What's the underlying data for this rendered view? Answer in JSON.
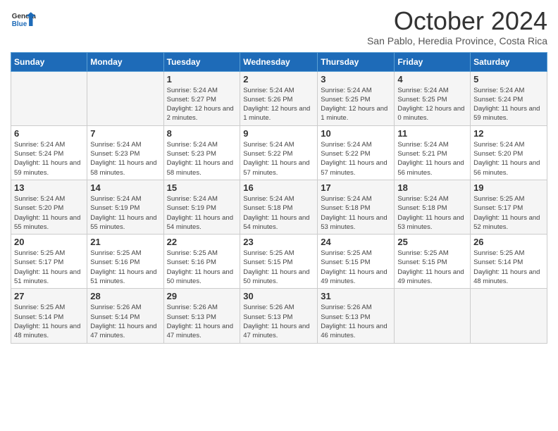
{
  "logo": {
    "line1": "General",
    "line2": "Blue"
  },
  "title": "October 2024",
  "subtitle": "San Pablo, Heredia Province, Costa Rica",
  "days_header": [
    "Sunday",
    "Monday",
    "Tuesday",
    "Wednesday",
    "Thursday",
    "Friday",
    "Saturday"
  ],
  "weeks": [
    [
      {
        "day": "",
        "sunrise": "",
        "sunset": "",
        "daylight": ""
      },
      {
        "day": "",
        "sunrise": "",
        "sunset": "",
        "daylight": ""
      },
      {
        "day": "1",
        "sunrise": "Sunrise: 5:24 AM",
        "sunset": "Sunset: 5:27 PM",
        "daylight": "Daylight: 12 hours and 2 minutes."
      },
      {
        "day": "2",
        "sunrise": "Sunrise: 5:24 AM",
        "sunset": "Sunset: 5:26 PM",
        "daylight": "Daylight: 12 hours and 1 minute."
      },
      {
        "day": "3",
        "sunrise": "Sunrise: 5:24 AM",
        "sunset": "Sunset: 5:25 PM",
        "daylight": "Daylight: 12 hours and 1 minute."
      },
      {
        "day": "4",
        "sunrise": "Sunrise: 5:24 AM",
        "sunset": "Sunset: 5:25 PM",
        "daylight": "Daylight: 12 hours and 0 minutes."
      },
      {
        "day": "5",
        "sunrise": "Sunrise: 5:24 AM",
        "sunset": "Sunset: 5:24 PM",
        "daylight": "Daylight: 11 hours and 59 minutes."
      }
    ],
    [
      {
        "day": "6",
        "sunrise": "Sunrise: 5:24 AM",
        "sunset": "Sunset: 5:24 PM",
        "daylight": "Daylight: 11 hours and 59 minutes."
      },
      {
        "day": "7",
        "sunrise": "Sunrise: 5:24 AM",
        "sunset": "Sunset: 5:23 PM",
        "daylight": "Daylight: 11 hours and 58 minutes."
      },
      {
        "day": "8",
        "sunrise": "Sunrise: 5:24 AM",
        "sunset": "Sunset: 5:23 PM",
        "daylight": "Daylight: 11 hours and 58 minutes."
      },
      {
        "day": "9",
        "sunrise": "Sunrise: 5:24 AM",
        "sunset": "Sunset: 5:22 PM",
        "daylight": "Daylight: 11 hours and 57 minutes."
      },
      {
        "day": "10",
        "sunrise": "Sunrise: 5:24 AM",
        "sunset": "Sunset: 5:22 PM",
        "daylight": "Daylight: 11 hours and 57 minutes."
      },
      {
        "day": "11",
        "sunrise": "Sunrise: 5:24 AM",
        "sunset": "Sunset: 5:21 PM",
        "daylight": "Daylight: 11 hours and 56 minutes."
      },
      {
        "day": "12",
        "sunrise": "Sunrise: 5:24 AM",
        "sunset": "Sunset: 5:20 PM",
        "daylight": "Daylight: 11 hours and 56 minutes."
      }
    ],
    [
      {
        "day": "13",
        "sunrise": "Sunrise: 5:24 AM",
        "sunset": "Sunset: 5:20 PM",
        "daylight": "Daylight: 11 hours and 55 minutes."
      },
      {
        "day": "14",
        "sunrise": "Sunrise: 5:24 AM",
        "sunset": "Sunset: 5:19 PM",
        "daylight": "Daylight: 11 hours and 55 minutes."
      },
      {
        "day": "15",
        "sunrise": "Sunrise: 5:24 AM",
        "sunset": "Sunset: 5:19 PM",
        "daylight": "Daylight: 11 hours and 54 minutes."
      },
      {
        "day": "16",
        "sunrise": "Sunrise: 5:24 AM",
        "sunset": "Sunset: 5:18 PM",
        "daylight": "Daylight: 11 hours and 54 minutes."
      },
      {
        "day": "17",
        "sunrise": "Sunrise: 5:24 AM",
        "sunset": "Sunset: 5:18 PM",
        "daylight": "Daylight: 11 hours and 53 minutes."
      },
      {
        "day": "18",
        "sunrise": "Sunrise: 5:24 AM",
        "sunset": "Sunset: 5:18 PM",
        "daylight": "Daylight: 11 hours and 53 minutes."
      },
      {
        "day": "19",
        "sunrise": "Sunrise: 5:25 AM",
        "sunset": "Sunset: 5:17 PM",
        "daylight": "Daylight: 11 hours and 52 minutes."
      }
    ],
    [
      {
        "day": "20",
        "sunrise": "Sunrise: 5:25 AM",
        "sunset": "Sunset: 5:17 PM",
        "daylight": "Daylight: 11 hours and 51 minutes."
      },
      {
        "day": "21",
        "sunrise": "Sunrise: 5:25 AM",
        "sunset": "Sunset: 5:16 PM",
        "daylight": "Daylight: 11 hours and 51 minutes."
      },
      {
        "day": "22",
        "sunrise": "Sunrise: 5:25 AM",
        "sunset": "Sunset: 5:16 PM",
        "daylight": "Daylight: 11 hours and 50 minutes."
      },
      {
        "day": "23",
        "sunrise": "Sunrise: 5:25 AM",
        "sunset": "Sunset: 5:15 PM",
        "daylight": "Daylight: 11 hours and 50 minutes."
      },
      {
        "day": "24",
        "sunrise": "Sunrise: 5:25 AM",
        "sunset": "Sunset: 5:15 PM",
        "daylight": "Daylight: 11 hours and 49 minutes."
      },
      {
        "day": "25",
        "sunrise": "Sunrise: 5:25 AM",
        "sunset": "Sunset: 5:15 PM",
        "daylight": "Daylight: 11 hours and 49 minutes."
      },
      {
        "day": "26",
        "sunrise": "Sunrise: 5:25 AM",
        "sunset": "Sunset: 5:14 PM",
        "daylight": "Daylight: 11 hours and 48 minutes."
      }
    ],
    [
      {
        "day": "27",
        "sunrise": "Sunrise: 5:25 AM",
        "sunset": "Sunset: 5:14 PM",
        "daylight": "Daylight: 11 hours and 48 minutes."
      },
      {
        "day": "28",
        "sunrise": "Sunrise: 5:26 AM",
        "sunset": "Sunset: 5:14 PM",
        "daylight": "Daylight: 11 hours and 47 minutes."
      },
      {
        "day": "29",
        "sunrise": "Sunrise: 5:26 AM",
        "sunset": "Sunset: 5:13 PM",
        "daylight": "Daylight: 11 hours and 47 minutes."
      },
      {
        "day": "30",
        "sunrise": "Sunrise: 5:26 AM",
        "sunset": "Sunset: 5:13 PM",
        "daylight": "Daylight: 11 hours and 47 minutes."
      },
      {
        "day": "31",
        "sunrise": "Sunrise: 5:26 AM",
        "sunset": "Sunset: 5:13 PM",
        "daylight": "Daylight: 11 hours and 46 minutes."
      },
      {
        "day": "",
        "sunrise": "",
        "sunset": "",
        "daylight": ""
      },
      {
        "day": "",
        "sunrise": "",
        "sunset": "",
        "daylight": ""
      }
    ]
  ]
}
